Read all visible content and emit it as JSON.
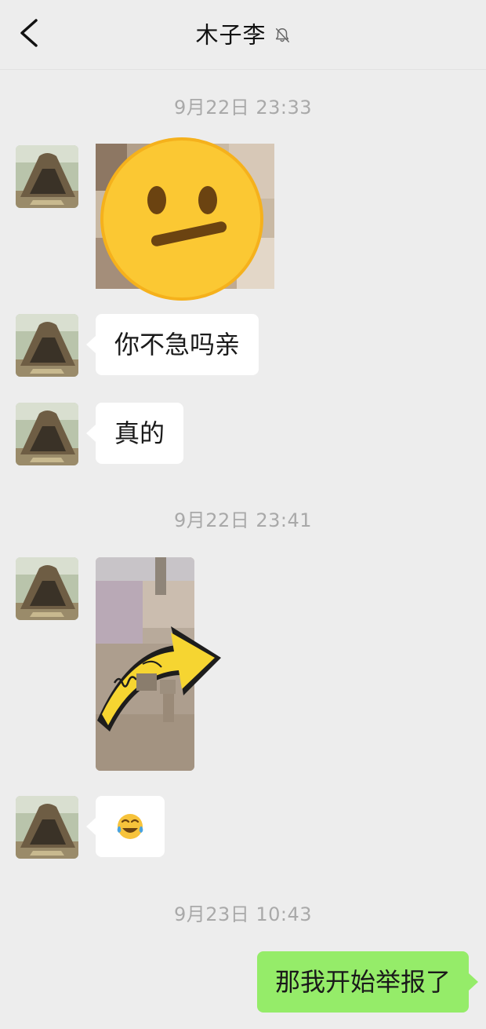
{
  "header": {
    "title": "木子李",
    "back_icon": "chevron-left-icon",
    "mute_icon": "bell-muted-icon"
  },
  "messages": {
    "ts1": "9月22日 23:33",
    "ts2": "9月22日 23:41",
    "ts3": "9月23日 10:43",
    "text1": "你不急吗亲",
    "text2": "真的",
    "text4": "那我开始举报了",
    "emoji_sticker": "tears-of-joy-emoji-icon"
  },
  "colors": {
    "background": "#ededed",
    "incoming_bubble": "#ffffff",
    "outgoing_bubble": "#95ec69",
    "timestamp": "#a9a9a9"
  }
}
